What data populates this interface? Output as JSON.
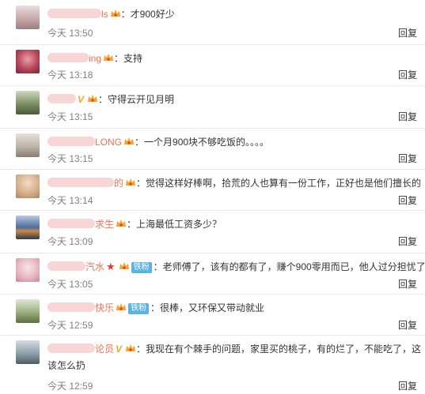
{
  "reply_label": "回复",
  "comments": [
    {
      "name_tail": "ls",
      "text": "：才900好少",
      "time": "今天 13:50"
    },
    {
      "name_tail": "ing",
      "text": "：支持",
      "time": "今天 13:18"
    },
    {
      "name_tail": "",
      "text": "：守得云开见月明",
      "time": "今天 13:15"
    },
    {
      "name_tail": "LONG",
      "text": "：一个月900块不够吃饭的。。。。",
      "time": "今天 13:15"
    },
    {
      "name_tail": "的",
      "text": "：觉得这样好棒啊，拾荒的人也算有一份工作，正好也是他们擅长的",
      "time": "今天 13:14"
    },
    {
      "name_tail": "求生",
      "text": "：上海最低工资多少？",
      "time": "今天 13:09"
    },
    {
      "name_tail": "汽水",
      "fan_label": "铁粉",
      "text": "：老师傅了，该有的都有了，赚个900零用而已，他人过分担忧了",
      "time": "今天 13:05"
    },
    {
      "name_tail": "快乐",
      "fan_label": "铁粉",
      "text": "：很棒，又环保又带动就业",
      "time": "今天 12:59"
    },
    {
      "name_tail": "论员",
      "text": "：我现在有个棘手的问题，家里买的桃子，有的烂了，不能吃了，这",
      "text_line2": "该怎么扔",
      "time": "今天 12:59"
    }
  ],
  "colors": {
    "username": "#eb7350",
    "meta": "#808080",
    "fan_badge": "#5bb3e4",
    "crown": "#f7a42a"
  }
}
